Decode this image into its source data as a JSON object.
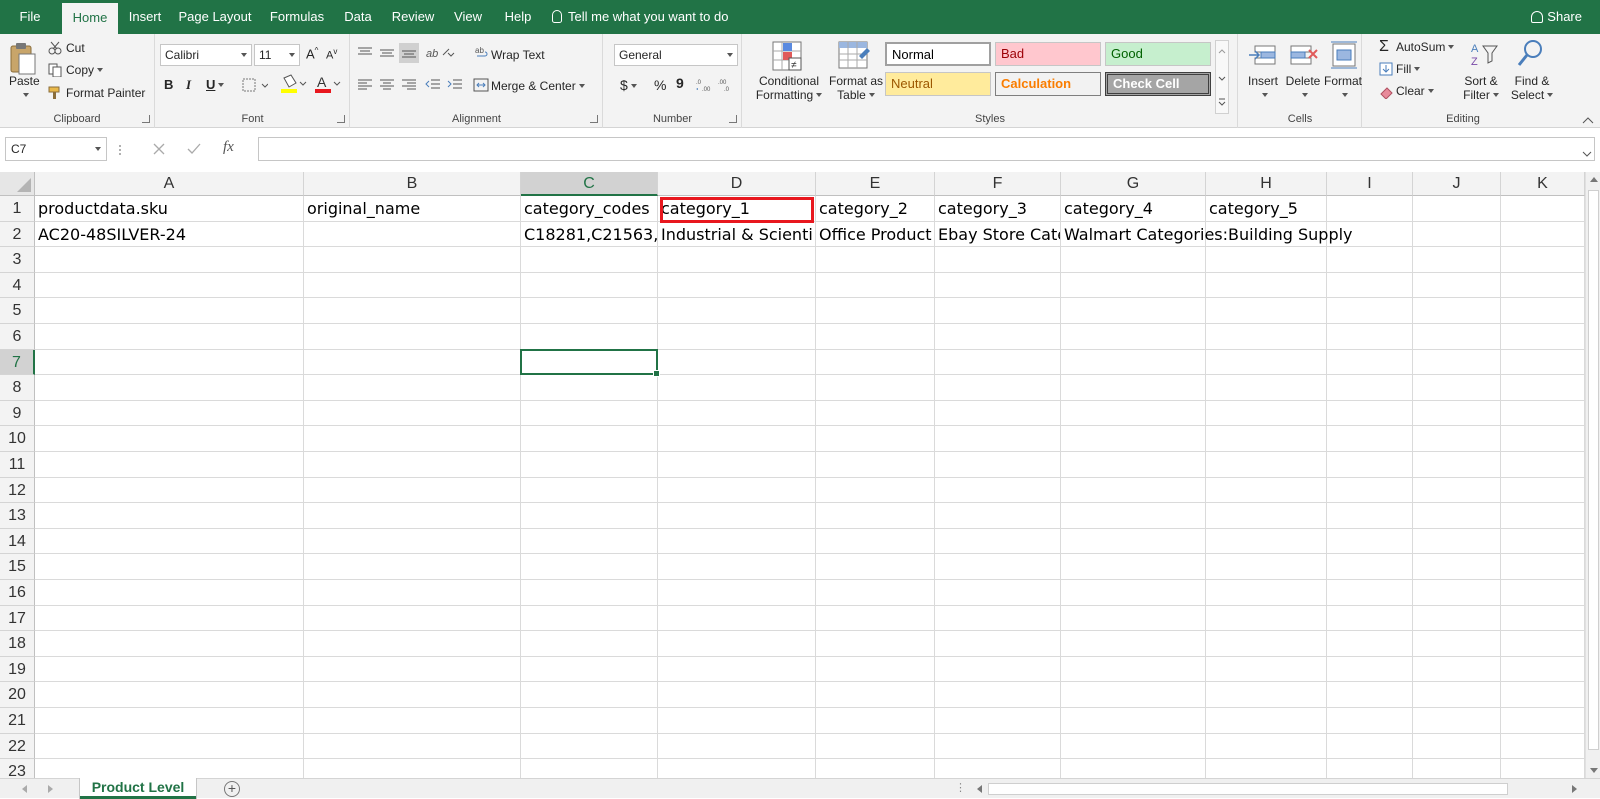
{
  "menu": {
    "tabs": [
      "File",
      "Home",
      "Insert",
      "Page Layout",
      "Formulas",
      "Data",
      "Review",
      "View",
      "Help"
    ],
    "active": "Home",
    "tell_me": "Tell me what you want to do",
    "share": "Share"
  },
  "ribbon": {
    "clipboard": {
      "label": "Clipboard",
      "paste": "Paste",
      "cut": "Cut",
      "copy": "Copy",
      "format_painter": "Format Painter"
    },
    "font": {
      "label": "Font",
      "family": "Calibri",
      "size": "11",
      "bold": "B",
      "italic": "I",
      "underline": "U",
      "grow": "A",
      "shrink": "A",
      "font_color_letter": "A",
      "fill_color": "#ffff00",
      "font_color": "#e8171e"
    },
    "alignment": {
      "label": "Alignment",
      "wrap_text": "Wrap Text",
      "merge_center": "Merge & Center"
    },
    "number": {
      "label": "Number",
      "format": "General",
      "currency": "$",
      "percent": "%",
      "comma": "9"
    },
    "styles": {
      "label": "Styles",
      "conditional_formatting": [
        "Conditional",
        "Formatting"
      ],
      "format_as_table": [
        "Format as",
        "Table"
      ],
      "cells": [
        {
          "name": "Normal",
          "bg": "#ffffff",
          "fg": "#000000"
        },
        {
          "name": "Bad",
          "bg": "#ffc7ce",
          "fg": "#9c0006"
        },
        {
          "name": "Good",
          "bg": "#c6efce",
          "fg": "#006100"
        },
        {
          "name": "Neutral",
          "bg": "#ffeb9c",
          "fg": "#9c5700"
        },
        {
          "name": "Calculation",
          "bg": "#f2f2f2",
          "fg": "#fa7d00"
        },
        {
          "name": "Check Cell",
          "bg": "#a5a5a5",
          "fg": "#ffffff"
        }
      ]
    },
    "cells": {
      "label": "Cells",
      "insert": "Insert",
      "delete": "Delete",
      "format": "Format"
    },
    "editing": {
      "label": "Editing",
      "autosum": "AutoSum",
      "fill": "Fill",
      "clear": "Clear",
      "sort_filter": [
        "Sort &",
        "Filter"
      ],
      "find_select": [
        "Find &",
        "Select"
      ]
    }
  },
  "formula_bar": {
    "name_box": "C7",
    "fx": "fx",
    "formula": ""
  },
  "sheet": {
    "columns": [
      "A",
      "B",
      "C",
      "D",
      "E",
      "F",
      "G",
      "H",
      "I",
      "J",
      "K"
    ],
    "selected_column": "C",
    "selected_row": 7,
    "row_count": 23,
    "rows": [
      [
        "productdata.sku",
        "original_name",
        "category_codes",
        "category_1",
        "category_2",
        "category_3",
        "category_4",
        "category_5",
        "",
        "",
        ""
      ],
      [
        "AC20-48SILVER-24",
        "",
        "C18281,C21563,",
        "Industrial & Scienti",
        "Office Product",
        "Ebay Store Cate",
        "Walmart Categories:Building Supply",
        "",
        "",
        "",
        ""
      ]
    ],
    "highlighted_cell": "D1",
    "highlight_color": "#e8171e",
    "accent": "#217346"
  },
  "sheet_tabs": {
    "tabs": [
      "Product Level"
    ],
    "active": "Product Level",
    "add": "+"
  }
}
